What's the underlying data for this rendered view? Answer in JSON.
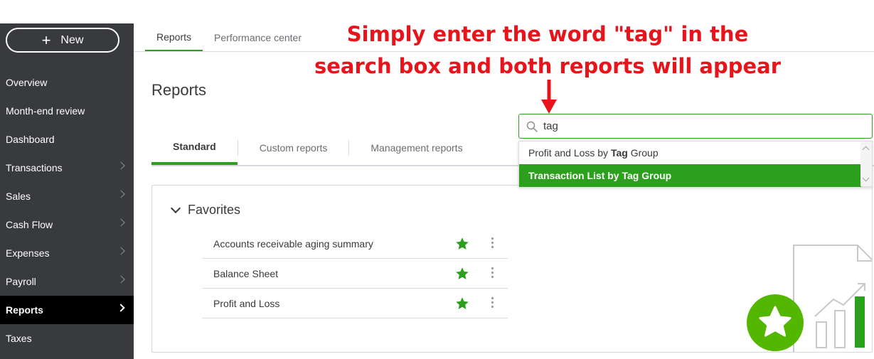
{
  "sidebar": {
    "new_label": "New",
    "items": [
      {
        "label": "Overview",
        "chevron": false
      },
      {
        "label": "Month-end review",
        "chevron": false
      },
      {
        "label": "Dashboard",
        "chevron": false
      },
      {
        "label": "Transactions",
        "chevron": true
      },
      {
        "label": "Sales",
        "chevron": true
      },
      {
        "label": "Cash Flow",
        "chevron": true
      },
      {
        "label": "Expenses",
        "chevron": true
      },
      {
        "label": "Payroll",
        "chevron": true
      },
      {
        "label": "Reports",
        "chevron": true,
        "active": true
      },
      {
        "label": "Taxes",
        "chevron": false
      }
    ]
  },
  "top_tabs": [
    {
      "label": "Reports",
      "active": true
    },
    {
      "label": "Performance center",
      "active": false
    }
  ],
  "annotation": {
    "line1": "Simply enter the word \"tag\" in the",
    "line2": "search box and both reports will appear",
    "color": "#e8141b"
  },
  "page": {
    "title": "Reports"
  },
  "report_tabs": [
    {
      "label": "Standard",
      "active": true
    },
    {
      "label": "Custom reports",
      "active": false
    },
    {
      "label": "Management reports",
      "active": false
    }
  ],
  "search": {
    "value": "tag",
    "icon": "search-icon"
  },
  "suggestions": [
    {
      "before": "Profit and Loss by ",
      "match": "Tag",
      "after": " Group",
      "highlighted": false
    },
    {
      "before": "Transaction List by ",
      "match": "Tag",
      "after": " Group",
      "highlighted": true
    }
  ],
  "favorites": {
    "title": "Favorites",
    "items": [
      {
        "name": "Accounts receivable aging summary",
        "starred": true
      },
      {
        "name": "Balance Sheet",
        "starred": true
      },
      {
        "name": "Profit and Loss",
        "starred": true
      }
    ]
  },
  "colors": {
    "brand_green": "#2ca01c",
    "sidebar_bg": "#393a3d",
    "text": "#393a3d"
  }
}
